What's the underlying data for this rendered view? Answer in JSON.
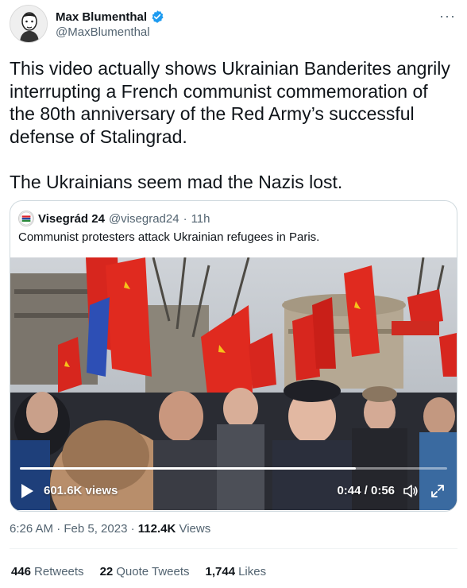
{
  "author": {
    "name": "Max Blumenthal",
    "handle": "@MaxBlumenthal"
  },
  "tweet": {
    "text": "This video actually shows Ukrainian Banderites angrily interrupting a French communist commemoration of the 80th anniversary of the Red Army’s successful defense of Stalingrad.\n\nThe Ukrainians seem mad the Nazis lost."
  },
  "quoted": {
    "name": "Visegrád 24",
    "handle": "@visegrad24",
    "dot": "·",
    "time": "11h",
    "text": "Communist protesters attack Ukrainian refugees in Paris.",
    "video": {
      "views": "601.6K views",
      "time": "0:44 / 0:56",
      "progress": 0.786
    }
  },
  "meta": {
    "time_date": "6:26 AM · Feb 5, 2023 · ",
    "views_count": "112.4K",
    "views_label": " Views"
  },
  "stats": {
    "retweets_count": "446",
    "retweets_label": "Retweets",
    "quotes_count": "22",
    "quotes_label": "Quote Tweets",
    "likes_count": "1,744",
    "likes_label": "Likes"
  },
  "colors": {
    "verified": "#1d9bf0",
    "secondary_text": "#536471",
    "flag_red": "#d7261e",
    "flag_yellow": "#f6c21a"
  },
  "icons": [
    "verified-badge-icon",
    "more-icon",
    "play-icon",
    "volume-icon",
    "fullscreen-icon"
  ]
}
